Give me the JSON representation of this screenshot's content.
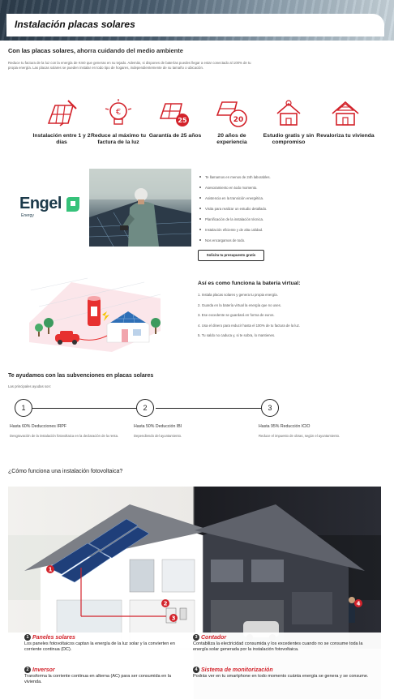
{
  "hero": {
    "title": "Instalación placas solares"
  },
  "intro": {
    "heading_light": "Con las placas solares, ",
    "heading_bold": "ahorra cuidando del medio ambiente",
    "paragraph": "Reduce tu factura de la luz con la energía de Km0 que generas en su tejado. Además, si dispones de baterías puedes llegar a estar conectado al 100% de tu propia energía. Las placas solares se pueden instalar en todo tipo de hogares, independientemente de su tamaño o ubicación."
  },
  "benefits": [
    {
      "icon": "solar-installation-icon",
      "label": "Instalación entre 1 y 2 días"
    },
    {
      "icon": "lightbulb-savings-icon",
      "label": "Reduce al máximo tu factura de la luz"
    },
    {
      "icon": "solar-guarantee-icon",
      "label": "Garantía de 25 años",
      "badge": "25"
    },
    {
      "icon": "experience-badge-icon",
      "label": "20 años de experiencia",
      "badge": "20"
    },
    {
      "icon": "free-study-icon",
      "label": "Estudio gratis y sin compromiso"
    },
    {
      "icon": "house-value-icon",
      "label": "Revaloriza tu vivienda"
    }
  ],
  "engel": {
    "brand": "Engel",
    "brand_sub": "Energy",
    "items": [
      "Te llamamos en menos de 24h laborables.",
      "Asesoramiento en todo momento.",
      "Asistencia en la transición energética.",
      "Visita para realizar un estudio detallado.",
      "Planificación de la instalación técnica.",
      "Instalación eficiente y de alta calidad.",
      "Nos encargamos de todo."
    ],
    "cta_label": "Solicita tu presupuesto gratis"
  },
  "battery": {
    "title": "Así es como funciona la batería virtual:",
    "steps": [
      "1. Instala placas solares y genera tu propia energía.",
      "2. Guarda en la batería virtual la energía que no uses.",
      "3. Ese excedente se guardará en forma de euros.",
      "4. Usa el dinero para reducir hasta el 100% de tu factura de la luz.",
      "5. Tu saldo no caduca y, si te sobra, lo mantienes."
    ]
  },
  "subsidies": {
    "title": "Te ayudamos con las subvenciones en placas solares",
    "hint": "Las principales ayudas son:",
    "steps": [
      {
        "number": "1",
        "title": "Hasta 60% Deducciones IRPF",
        "desc": "Desgravación de la instalación fotovoltaica en la declaración de la renta."
      },
      {
        "number": "2",
        "title": "Hasta 50% Deducción IBI",
        "desc": "Dependiendo del ayuntamiento."
      },
      {
        "number": "3",
        "title": "Hasta 95% Reducción ICIO",
        "desc": "Reduce el impuesto de obras, según el ayuntamiento."
      }
    ]
  },
  "photovoltaic": {
    "title": "¿Cómo funciona una instalación fotovoltaica?",
    "markers": [
      "1",
      "2",
      "3",
      "4"
    ],
    "legend": [
      {
        "number": "1",
        "title": "Paneles solares",
        "desc": "Los paneles fotovoltaicos captan la energía de la luz solar y la convierten en corriente continua (DC)."
      },
      {
        "number": "3",
        "title": "Contador",
        "desc": "Contabiliza la electricidad consumida y los excedentes cuando no se consume toda la energía solar generada por la instalación fotovoltaica."
      },
      {
        "number": "2",
        "title": "Inversor",
        "desc": "Transforma la corriente continua en alterna (AC) para ser consumida en la vivienda."
      },
      {
        "number": "4",
        "title": "Sistema de monitorización",
        "desc": "Podrás ver en tu smartphone en todo momento cuánta energía se genera y se consume."
      }
    ]
  },
  "colors": {
    "accent_red": "#d3232b",
    "engel_teal": "#1c3a4a",
    "engel_green": "#36c27a"
  }
}
